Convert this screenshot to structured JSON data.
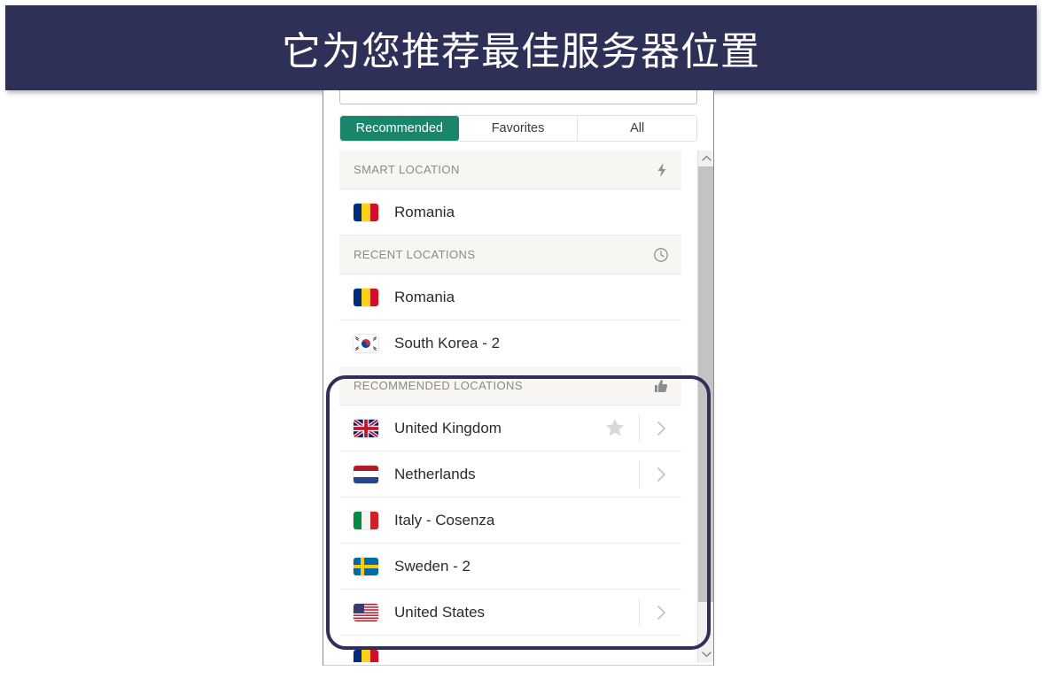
{
  "banner": {
    "text": "它为您推荐最佳服务器位置",
    "bg_color": "#2f3058",
    "text_color": "#ffffff"
  },
  "panel": {
    "search": {
      "value": "",
      "placeholder": ""
    },
    "tabs": [
      {
        "label": "Recommended",
        "active": true
      },
      {
        "label": "Favorites",
        "active": false
      },
      {
        "label": "All",
        "active": false
      }
    ],
    "accent_color": "#19856a",
    "sections": [
      {
        "title": "SMART LOCATION",
        "icon": "lightning-bolt-icon",
        "items": [
          {
            "name": "Romania",
            "flag": "romania",
            "star": false,
            "chevron": false
          }
        ]
      },
      {
        "title": "RECENT LOCATIONS",
        "icon": "clock-icon",
        "items": [
          {
            "name": "Romania",
            "flag": "romania",
            "star": false,
            "chevron": false
          },
          {
            "name": "South Korea - 2",
            "flag": "south-korea",
            "star": false,
            "chevron": false
          }
        ]
      },
      {
        "title": "RECOMMENDED LOCATIONS",
        "icon": "thumbs-up-icon",
        "highlighted": true,
        "items": [
          {
            "name": "United Kingdom",
            "flag": "united-kingdom",
            "star": true,
            "chevron": true
          },
          {
            "name": "Netherlands",
            "flag": "netherlands",
            "star": false,
            "chevron": true
          },
          {
            "name": "Italy - Cosenza",
            "flag": "italy",
            "star": false,
            "chevron": false
          },
          {
            "name": "Sweden - 2",
            "flag": "sweden",
            "star": false,
            "chevron": false
          },
          {
            "name": "United States",
            "flag": "united-states",
            "star": false,
            "chevron": true
          },
          {
            "name": "",
            "flag": "romania",
            "star": false,
            "chevron": false
          }
        ]
      }
    ],
    "scrollbar": {
      "up_label": "scroll-up",
      "down_label": "scroll-down"
    }
  },
  "highlight": {
    "color": "#2f3058"
  }
}
